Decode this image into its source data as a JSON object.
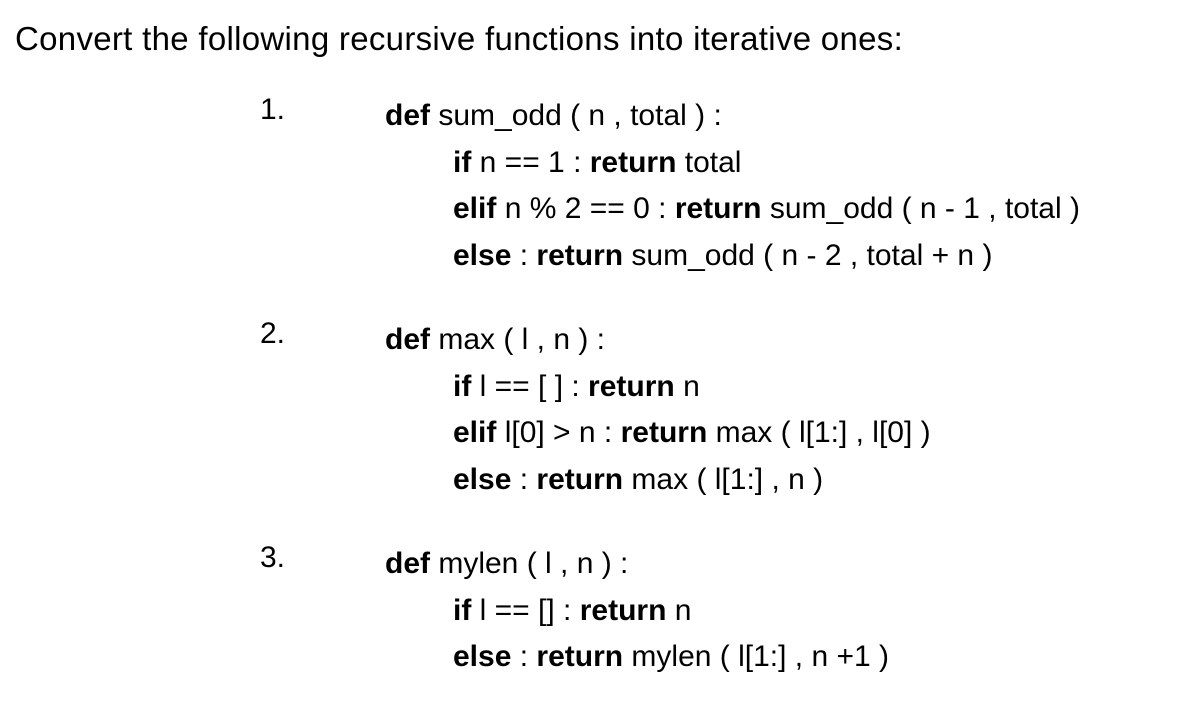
{
  "title": "Convert the following recursive functions into iterative ones:",
  "items": [
    {
      "num": "1.",
      "def_kw": "def",
      "def_sig": " sum_odd ( n , total ) :",
      "l1_kw": "if",
      "l1_a": " n == 1 : ",
      "l1_ret": "return",
      "l1_b": " total",
      "l2_kw": "elif",
      "l2_a": " n % 2 == 0 : ",
      "l2_ret": "return",
      "l2_b": " sum_odd ( n - 1 , total )",
      "l3_kw": "else",
      "l3_a": " : ",
      "l3_ret": "return",
      "l3_b": " sum_odd ( n - 2 , total + n )"
    },
    {
      "num": "2.",
      "def_kw": "def",
      "def_sig": " max ( l , n ) :",
      "l1_kw": "if",
      "l1_a": " l == [ ] : ",
      "l1_ret": "return",
      "l1_b": " n",
      "l2_kw": "elif",
      "l2_a": " l[0] > n : ",
      "l2_ret": "return",
      "l2_b": " max ( l[1:] , l[0] )",
      "l3_kw": "else",
      "l3_a": " : ",
      "l3_ret": "return",
      "l3_b": " max ( l[1:] , n )"
    },
    {
      "num": "3.",
      "def_kw": "def",
      "def_sig": " mylen ( l , n ) :",
      "l1_kw": "if",
      "l1_a": " l == [] : ",
      "l1_ret": "return",
      "l1_b": " n",
      "l2_kw": "else",
      "l2_a": " : ",
      "l2_ret": "return",
      "l2_b": " mylen ( l[1:] , n +1 )",
      "l3_kw": "",
      "l3_a": "",
      "l3_ret": "",
      "l3_b": ""
    }
  ]
}
